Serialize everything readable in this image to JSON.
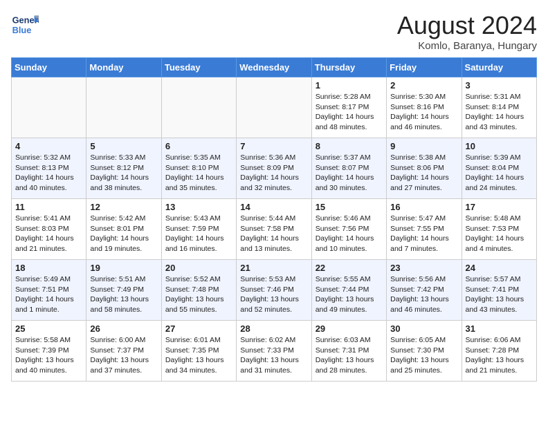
{
  "logo": {
    "line1": "General",
    "line2": "Blue"
  },
  "title": "August 2024",
  "location": "Komlo, Baranya, Hungary",
  "days_of_week": [
    "Sunday",
    "Monday",
    "Tuesday",
    "Wednesday",
    "Thursday",
    "Friday",
    "Saturday"
  ],
  "weeks": [
    [
      {
        "day": "",
        "info": ""
      },
      {
        "day": "",
        "info": ""
      },
      {
        "day": "",
        "info": ""
      },
      {
        "day": "",
        "info": ""
      },
      {
        "day": "1",
        "info": "Sunrise: 5:28 AM\nSunset: 8:17 PM\nDaylight: 14 hours\nand 48 minutes."
      },
      {
        "day": "2",
        "info": "Sunrise: 5:30 AM\nSunset: 8:16 PM\nDaylight: 14 hours\nand 46 minutes."
      },
      {
        "day": "3",
        "info": "Sunrise: 5:31 AM\nSunset: 8:14 PM\nDaylight: 14 hours\nand 43 minutes."
      }
    ],
    [
      {
        "day": "4",
        "info": "Sunrise: 5:32 AM\nSunset: 8:13 PM\nDaylight: 14 hours\nand 40 minutes."
      },
      {
        "day": "5",
        "info": "Sunrise: 5:33 AM\nSunset: 8:12 PM\nDaylight: 14 hours\nand 38 minutes."
      },
      {
        "day": "6",
        "info": "Sunrise: 5:35 AM\nSunset: 8:10 PM\nDaylight: 14 hours\nand 35 minutes."
      },
      {
        "day": "7",
        "info": "Sunrise: 5:36 AM\nSunset: 8:09 PM\nDaylight: 14 hours\nand 32 minutes."
      },
      {
        "day": "8",
        "info": "Sunrise: 5:37 AM\nSunset: 8:07 PM\nDaylight: 14 hours\nand 30 minutes."
      },
      {
        "day": "9",
        "info": "Sunrise: 5:38 AM\nSunset: 8:06 PM\nDaylight: 14 hours\nand 27 minutes."
      },
      {
        "day": "10",
        "info": "Sunrise: 5:39 AM\nSunset: 8:04 PM\nDaylight: 14 hours\nand 24 minutes."
      }
    ],
    [
      {
        "day": "11",
        "info": "Sunrise: 5:41 AM\nSunset: 8:03 PM\nDaylight: 14 hours\nand 21 minutes."
      },
      {
        "day": "12",
        "info": "Sunrise: 5:42 AM\nSunset: 8:01 PM\nDaylight: 14 hours\nand 19 minutes."
      },
      {
        "day": "13",
        "info": "Sunrise: 5:43 AM\nSunset: 7:59 PM\nDaylight: 14 hours\nand 16 minutes."
      },
      {
        "day": "14",
        "info": "Sunrise: 5:44 AM\nSunset: 7:58 PM\nDaylight: 14 hours\nand 13 minutes."
      },
      {
        "day": "15",
        "info": "Sunrise: 5:46 AM\nSunset: 7:56 PM\nDaylight: 14 hours\nand 10 minutes."
      },
      {
        "day": "16",
        "info": "Sunrise: 5:47 AM\nSunset: 7:55 PM\nDaylight: 14 hours\nand 7 minutes."
      },
      {
        "day": "17",
        "info": "Sunrise: 5:48 AM\nSunset: 7:53 PM\nDaylight: 14 hours\nand 4 minutes."
      }
    ],
    [
      {
        "day": "18",
        "info": "Sunrise: 5:49 AM\nSunset: 7:51 PM\nDaylight: 14 hours\nand 1 minute."
      },
      {
        "day": "19",
        "info": "Sunrise: 5:51 AM\nSunset: 7:49 PM\nDaylight: 13 hours\nand 58 minutes."
      },
      {
        "day": "20",
        "info": "Sunrise: 5:52 AM\nSunset: 7:48 PM\nDaylight: 13 hours\nand 55 minutes."
      },
      {
        "day": "21",
        "info": "Sunrise: 5:53 AM\nSunset: 7:46 PM\nDaylight: 13 hours\nand 52 minutes."
      },
      {
        "day": "22",
        "info": "Sunrise: 5:55 AM\nSunset: 7:44 PM\nDaylight: 13 hours\nand 49 minutes."
      },
      {
        "day": "23",
        "info": "Sunrise: 5:56 AM\nSunset: 7:42 PM\nDaylight: 13 hours\nand 46 minutes."
      },
      {
        "day": "24",
        "info": "Sunrise: 5:57 AM\nSunset: 7:41 PM\nDaylight: 13 hours\nand 43 minutes."
      }
    ],
    [
      {
        "day": "25",
        "info": "Sunrise: 5:58 AM\nSunset: 7:39 PM\nDaylight: 13 hours\nand 40 minutes."
      },
      {
        "day": "26",
        "info": "Sunrise: 6:00 AM\nSunset: 7:37 PM\nDaylight: 13 hours\nand 37 minutes."
      },
      {
        "day": "27",
        "info": "Sunrise: 6:01 AM\nSunset: 7:35 PM\nDaylight: 13 hours\nand 34 minutes."
      },
      {
        "day": "28",
        "info": "Sunrise: 6:02 AM\nSunset: 7:33 PM\nDaylight: 13 hours\nand 31 minutes."
      },
      {
        "day": "29",
        "info": "Sunrise: 6:03 AM\nSunset: 7:31 PM\nDaylight: 13 hours\nand 28 minutes."
      },
      {
        "day": "30",
        "info": "Sunrise: 6:05 AM\nSunset: 7:30 PM\nDaylight: 13 hours\nand 25 minutes."
      },
      {
        "day": "31",
        "info": "Sunrise: 6:06 AM\nSunset: 7:28 PM\nDaylight: 13 hours\nand 21 minutes."
      }
    ]
  ]
}
